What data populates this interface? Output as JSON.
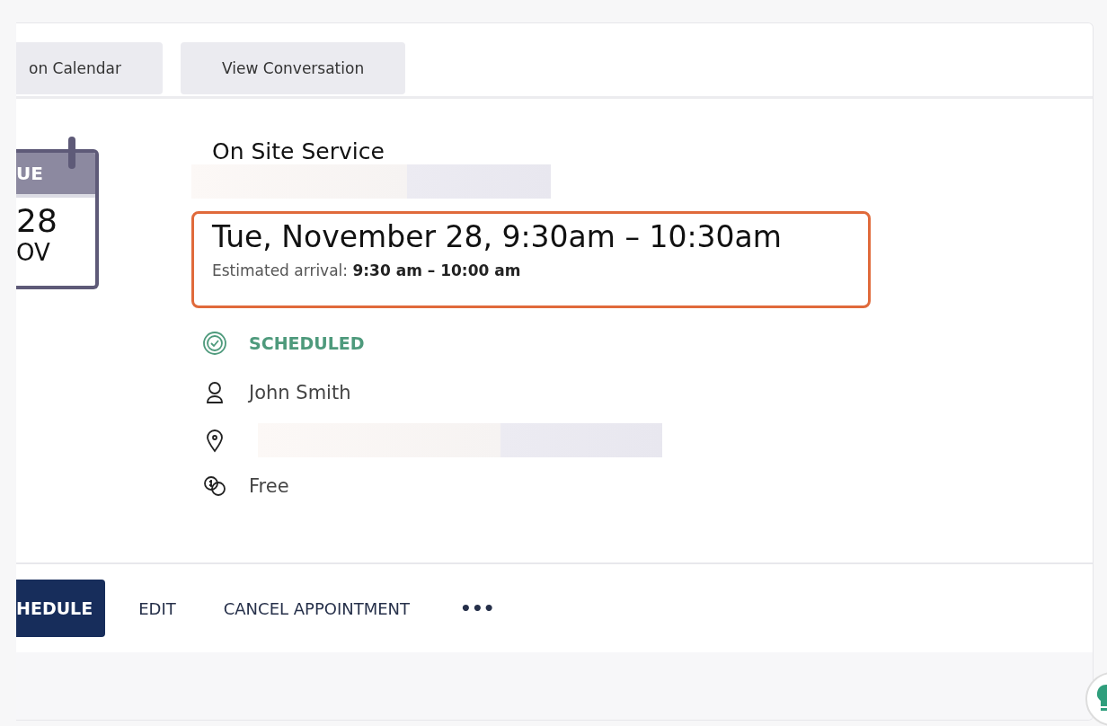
{
  "top_buttons": [
    {
      "label": "on Calendar"
    },
    {
      "label": "View Conversation"
    }
  ],
  "calendar": {
    "weekday": "UE",
    "day": "28",
    "month": "OV"
  },
  "appointment": {
    "service": "On Site Service",
    "datetime": "Tue, November 28, 9:30am – 10:30am",
    "arrival_label": "Estimated arrival:",
    "arrival_value": "9:30 am – 10:00 am",
    "highlighted": true
  },
  "details": [
    {
      "kind": "status",
      "text": "SCHEDULED"
    },
    {
      "kind": "person",
      "text": "John Smith"
    },
    {
      "kind": "location"
    },
    {
      "kind": "price",
      "text": "Free"
    }
  ],
  "actions": [
    {
      "kind": "primary",
      "label": "HEDULE"
    },
    {
      "kind": "text",
      "label": "EDIT"
    },
    {
      "kind": "text",
      "label": "CANCEL APPOINTMENT"
    },
    {
      "kind": "more",
      "label": "•••"
    }
  ]
}
